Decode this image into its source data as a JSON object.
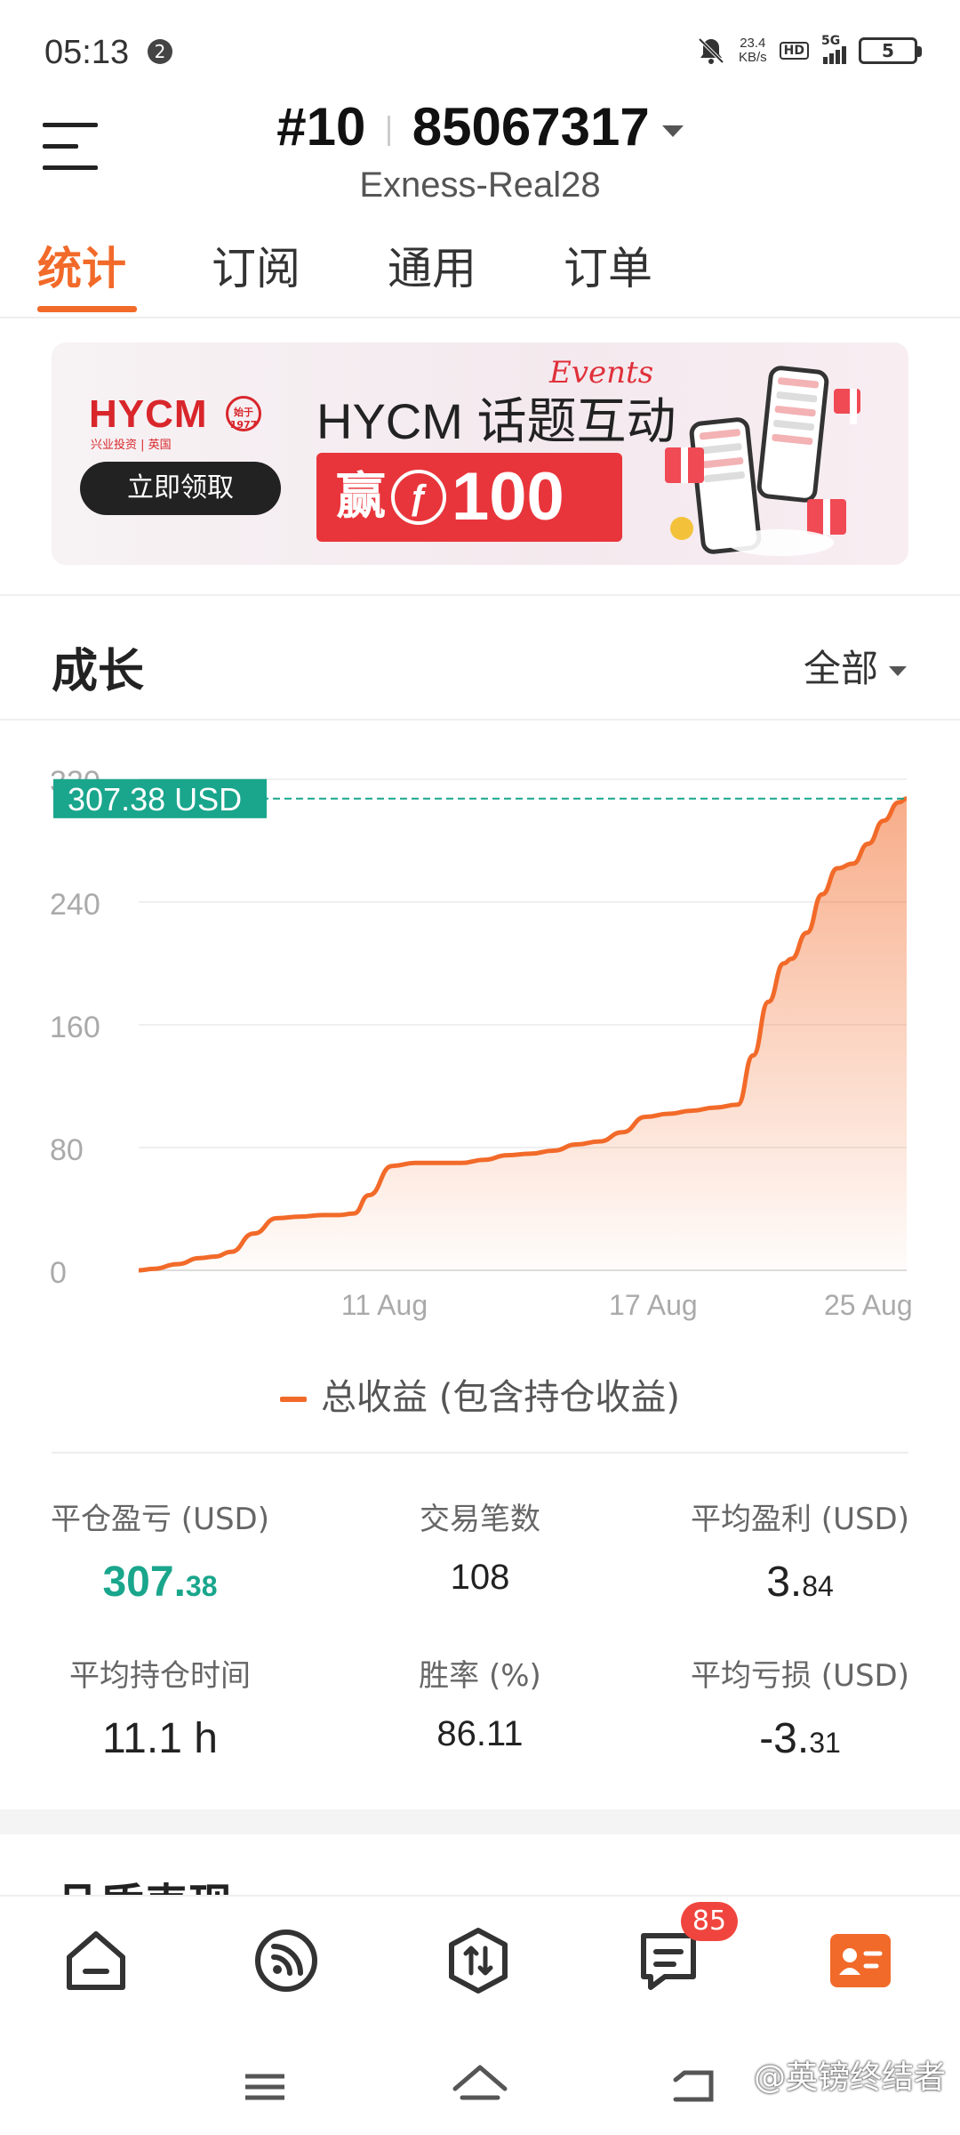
{
  "status_bar": {
    "time": "05:13",
    "notification_count": "2",
    "network_speed_value": "23.4",
    "network_speed_unit": "KB/s",
    "hd_label": "HD",
    "signal_label": "5G",
    "battery": "5"
  },
  "header": {
    "account_prefix": "#10",
    "account_number": "85067317",
    "server": "Exness-Real28"
  },
  "tabs": [
    {
      "label": "统计",
      "active": true
    },
    {
      "label": "订阅",
      "active": false
    },
    {
      "label": "通用",
      "active": false
    },
    {
      "label": "订单",
      "active": false
    }
  ],
  "banner": {
    "brand": "HYCM",
    "brand_sub": "兴业投资 | 英国",
    "seal_text": "始于 1977",
    "button_label": "立即领取",
    "title": "HYCM 话题互动",
    "script_text": "Events",
    "win_prefix": "赢",
    "coin_symbol": "ƒ",
    "amount": "100"
  },
  "growth_section": {
    "title": "成长",
    "filter_label": "全部"
  },
  "chart_data": {
    "type": "area",
    "current_value_label": "307.38 USD",
    "current_value": 307.38,
    "y_ticks": [
      "0",
      "80",
      "160",
      "240",
      "320"
    ],
    "ylim": [
      0,
      320
    ],
    "x_ticks": [
      "11 Aug",
      "17 Aug",
      "25 Aug"
    ],
    "x_tick_positions": [
      0.32,
      0.67,
      0.95
    ],
    "series": [
      {
        "name": "总收益 (包含持仓收益)",
        "color": "#f26a29",
        "x": [
          0,
          0.02,
          0.05,
          0.08,
          0.1,
          0.12,
          0.15,
          0.18,
          0.21,
          0.24,
          0.26,
          0.28,
          0.3,
          0.33,
          0.36,
          0.39,
          0.42,
          0.45,
          0.48,
          0.51,
          0.54,
          0.57,
          0.6,
          0.63,
          0.66,
          0.69,
          0.72,
          0.75,
          0.78,
          0.8,
          0.82,
          0.84,
          0.85,
          0.87,
          0.89,
          0.91,
          0.93,
          0.95,
          0.97,
          0.99,
          1.0
        ],
        "values": [
          0,
          1,
          4,
          8,
          9,
          12,
          24,
          34,
          35,
          36,
          36,
          37,
          49,
          68,
          70,
          70,
          70,
          72,
          75,
          76,
          78,
          82,
          84,
          90,
          100,
          102,
          104,
          106,
          108,
          140,
          175,
          200,
          203,
          220,
          245,
          262,
          265,
          278,
          293,
          305,
          307.38
        ]
      }
    ],
    "legend": "总收益 (包含持仓收益)",
    "grid": true
  },
  "stats": [
    {
      "label": "平仓盈亏 (USD)",
      "value_main": "307.",
      "value_small": "38",
      "highlight": true
    },
    {
      "label": "交易笔数",
      "value_main": "108",
      "value_small": ""
    },
    {
      "label": "平均盈利 (USD)",
      "value_main": "3.",
      "value_small": "84"
    },
    {
      "label": "平均持仓时间",
      "value_main": "11.1 h",
      "value_small": ""
    },
    {
      "label": "胜率 (%)",
      "value_main": "86.11",
      "value_small": ""
    },
    {
      "label": "平均亏损 (USD)",
      "value_main": "-3.",
      "value_small": "31"
    }
  ],
  "next_section_title": "品质表现",
  "bottom_nav": {
    "items": [
      "home-icon",
      "feed-icon",
      "trade-icon",
      "messages-icon",
      "profile-icon"
    ],
    "message_badge": "85",
    "accent": "#f26a29"
  },
  "watermark": "@英镑终结者"
}
